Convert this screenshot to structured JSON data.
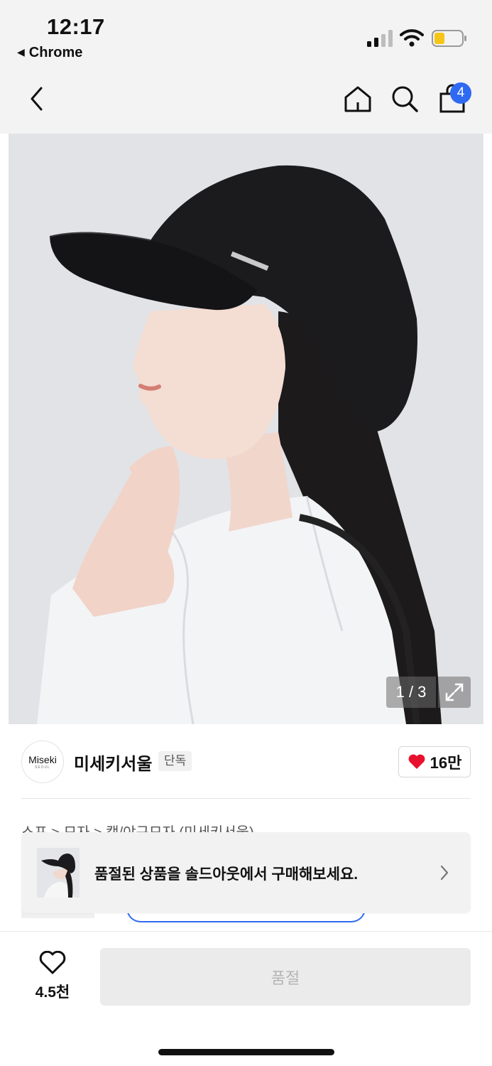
{
  "status_bar": {
    "time": "12:17",
    "back_app": "Chrome",
    "battery_color": "#f5c518"
  },
  "nav": {
    "back_icon": "chevron-left-icon",
    "home_icon": "home-icon",
    "search_icon": "search-icon",
    "cart_icon": "shopping-bag-icon",
    "cart_count": "4",
    "badge_color": "#2f6bf2"
  },
  "gallery": {
    "counter": "1 / 3",
    "expand_icon": "expand-icon"
  },
  "brand": {
    "logo_text": "Miseki",
    "logo_subtext": "SEOUL",
    "name": "미세키서울",
    "badge": "단독",
    "like_count": "16만",
    "like_icon": "heart-filled-icon",
    "like_color": "#e8112d"
  },
  "breadcrumb": "스포 > 모자 > 캡/야구모자 (미세키서울)",
  "soldout_banner": {
    "text": "품절된 상품을 솔드아웃에서 구매해보세요.",
    "chevron_icon": "chevron-right-icon"
  },
  "bottom_bar": {
    "wish_icon": "heart-outline-icon",
    "wish_count": "4.5천",
    "primary_button": "품절"
  }
}
